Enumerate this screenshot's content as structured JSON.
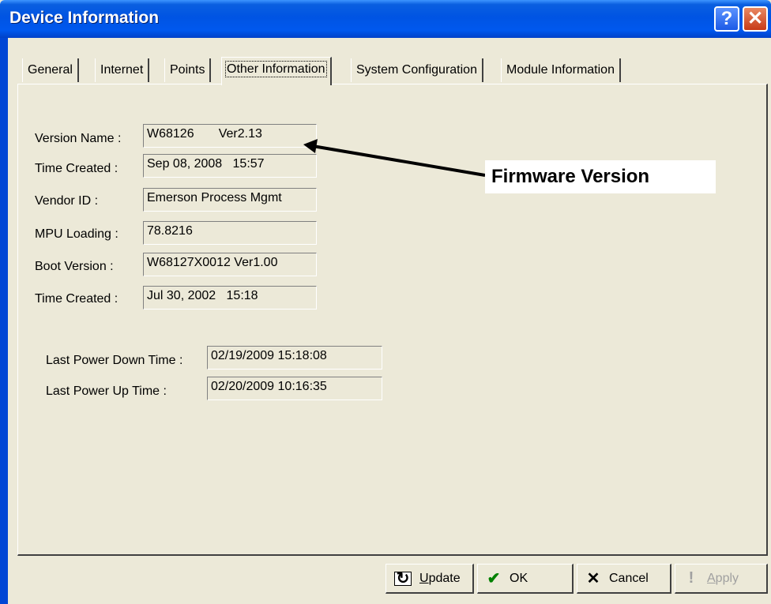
{
  "window": {
    "title": "Device Information"
  },
  "titlebar": {
    "help_glyph": "?",
    "close_glyph": "✕"
  },
  "tabs": [
    {
      "label": "General"
    },
    {
      "label": "Internet"
    },
    {
      "label": "Points"
    },
    {
      "label": "Other Information",
      "active": true
    },
    {
      "label": "System Configuration"
    },
    {
      "label": "Module Information"
    }
  ],
  "fields": {
    "version_name": {
      "label": "Version Name :",
      "value": "W68126       Ver2.13"
    },
    "time_created_1": {
      "label": "Time Created :",
      "value": "Sep 08, 2008   15:57"
    },
    "vendor_id": {
      "label": "Vendor ID :",
      "value": "Emerson Process Mgmt"
    },
    "mpu_loading": {
      "label": "MPU Loading :",
      "value": "78.8216"
    },
    "boot_version": {
      "label": "Boot Version :",
      "value": "W68127X0012 Ver1.00"
    },
    "time_created_2": {
      "label": "Time Created :",
      "value": "Jul 30, 2002   15:18"
    },
    "last_power_down": {
      "label": "Last Power Down Time :",
      "value": "02/19/2009 15:18:08"
    },
    "last_power_up": {
      "label": "Last Power Up Time :",
      "value": "02/20/2009 10:16:35"
    }
  },
  "annotation": {
    "text": "Firmware Version"
  },
  "buttons": {
    "update": {
      "label_first": "U",
      "label_rest": "pdate",
      "icon": "update-icon"
    },
    "ok": {
      "label": "OK",
      "icon": "checkmark-icon",
      "icon_glyph": "✔",
      "icon_color": "#008000"
    },
    "cancel": {
      "label": "Cancel",
      "icon": "x-icon",
      "icon_glyph": "✕"
    },
    "apply": {
      "label_first": "A",
      "label_rest": "pply",
      "icon": "exclamation-icon",
      "icon_glyph": "!",
      "disabled": true
    }
  },
  "colors": {
    "titlebar": "#0054e3",
    "face": "#ece9d8",
    "close": "#c73a18",
    "disabled_text": "#a0a0a0"
  }
}
